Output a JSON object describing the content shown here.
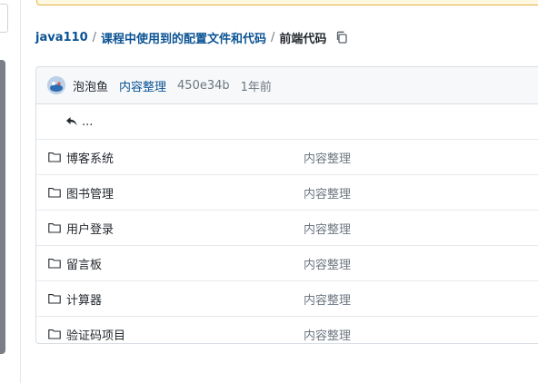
{
  "breadcrumb": {
    "repo": "java110",
    "folder": "课程中使用到的配置文件和代码",
    "current": "前端代码",
    "separator": "/"
  },
  "commit": {
    "author": "泡泡鱼",
    "message": "内容整理",
    "hash": "450e34b",
    "time": "1年前"
  },
  "parent_link": "...",
  "entries": [
    {
      "name": "博客系统",
      "message": "内容整理"
    },
    {
      "name": "图书管理",
      "message": "内容整理"
    },
    {
      "name": "用户登录",
      "message": "内容整理"
    },
    {
      "name": "留言板",
      "message": "内容整理"
    },
    {
      "name": "计算器",
      "message": "内容整理"
    },
    {
      "name": "验证码项目",
      "message": "内容整理"
    }
  ],
  "icons": {
    "copy": "copy-icon",
    "folder": "folder-icon",
    "back": "reply-arrow-icon",
    "avatar": "user-avatar"
  },
  "colors": {
    "link": "#0b5394",
    "muted": "#6e7781",
    "border": "#d8dee4"
  }
}
